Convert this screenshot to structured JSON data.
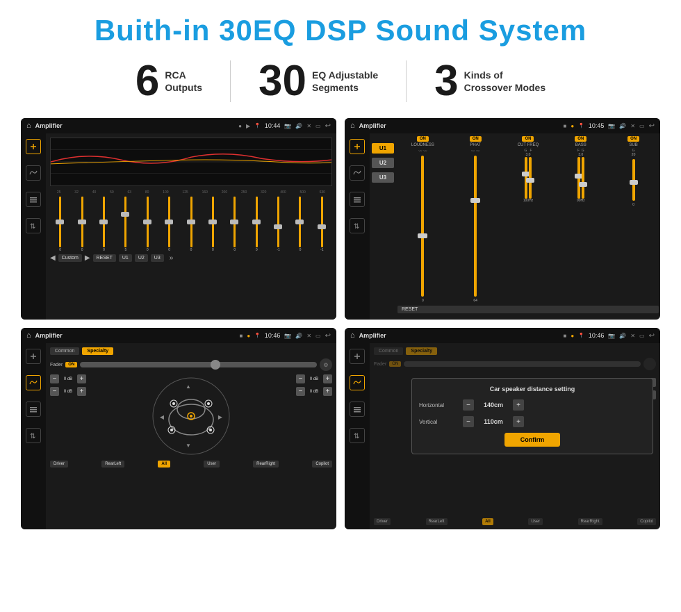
{
  "header": {
    "title": "Buith-in 30EQ DSP Sound System"
  },
  "stats": [
    {
      "number": "6",
      "desc_line1": "RCA",
      "desc_line2": "Outputs"
    },
    {
      "number": "30",
      "desc_line1": "EQ Adjustable",
      "desc_line2": "Segments"
    },
    {
      "number": "3",
      "desc_line1": "Kinds of",
      "desc_line2": "Crossover Modes"
    }
  ],
  "screens": [
    {
      "id": "eq-screen",
      "statusbar": {
        "title": "Amplifier",
        "time": "10:44"
      },
      "eq_labels": [
        "25",
        "32",
        "40",
        "50",
        "63",
        "80",
        "100",
        "125",
        "160",
        "200",
        "250",
        "320",
        "400",
        "500",
        "630"
      ],
      "eq_values": [
        "0",
        "0",
        "0",
        "5",
        "0",
        "0",
        "0",
        "0",
        "0",
        "0",
        "-1",
        "0",
        "-1"
      ],
      "bottom_buttons": [
        "Custom",
        "RESET",
        "U1",
        "U2",
        "U3"
      ]
    },
    {
      "id": "crossover-screen",
      "statusbar": {
        "title": "Amplifier",
        "time": "10:45"
      },
      "u_buttons": [
        "U1",
        "U2",
        "U3"
      ],
      "channels": [
        {
          "label": "LOUDNESS",
          "on": true
        },
        {
          "label": "PHAT",
          "on": true
        },
        {
          "label": "CUT FREQ",
          "on": true
        },
        {
          "label": "BASS",
          "on": true
        },
        {
          "label": "SUB",
          "on": true
        }
      ],
      "reset_btn": "RESET"
    },
    {
      "id": "speaker-screen",
      "statusbar": {
        "title": "Amplifier",
        "time": "10:46"
      },
      "tabs": [
        "Common",
        "Specialty"
      ],
      "active_tab": "Specialty",
      "fader_label": "Fader",
      "fader_on": "ON",
      "db_values": [
        "0 dB",
        "0 dB",
        "0 dB",
        "0 dB"
      ],
      "speaker_labels": [
        "Driver",
        "RearLeft",
        "All",
        "User",
        "RearRight",
        "Copilot"
      ]
    },
    {
      "id": "distance-screen",
      "statusbar": {
        "title": "Amplifier",
        "time": "10:46"
      },
      "tabs": [
        "Common",
        "Specialty"
      ],
      "dialog": {
        "title": "Car speaker distance setting",
        "horizontal_label": "Horizontal",
        "horizontal_value": "140cm",
        "vertical_label": "Vertical",
        "vertical_value": "110cm",
        "confirm_label": "Confirm"
      },
      "db_values": [
        "0 dB",
        "0 dB"
      ],
      "speaker_labels": [
        "Driver",
        "RearLeft",
        "All",
        "User",
        "RearRight",
        "Copilot"
      ]
    }
  ],
  "icons": {
    "home": "⌂",
    "play": "▶",
    "back": "↩",
    "pin": "📍",
    "camera": "📷",
    "speaker": "🔊",
    "x": "✕",
    "window": "▭",
    "eq_vertical": "≡",
    "wave": "〰",
    "arrows": "⇅",
    "minus": "−",
    "plus": "+"
  }
}
